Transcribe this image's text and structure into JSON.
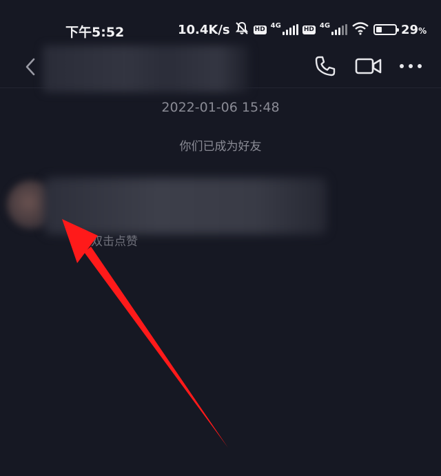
{
  "status_bar": {
    "time": "下午5:52",
    "net_speed": "10.4K/s",
    "hd_label": "HD",
    "network_label": "4G",
    "battery_percent_value": 29,
    "battery_number": "29",
    "battery_unit": "%",
    "icons": [
      "mute-bell-icon",
      "signal-icon",
      "wifi-icon",
      "battery-icon"
    ]
  },
  "nav": {
    "back_icon": "chevron-left-icon",
    "actions": [
      "phone-icon",
      "video-camera-icon",
      "more-icon"
    ]
  },
  "chat": {
    "timestamp": "2022-01-06 15:48",
    "system_message": "你们已成为好友",
    "like_hint": "双击点赞"
  },
  "colors": {
    "background": "#161823",
    "secondary_text": "#8a8b95",
    "annotation_arrow": "#ff1a1a"
  }
}
